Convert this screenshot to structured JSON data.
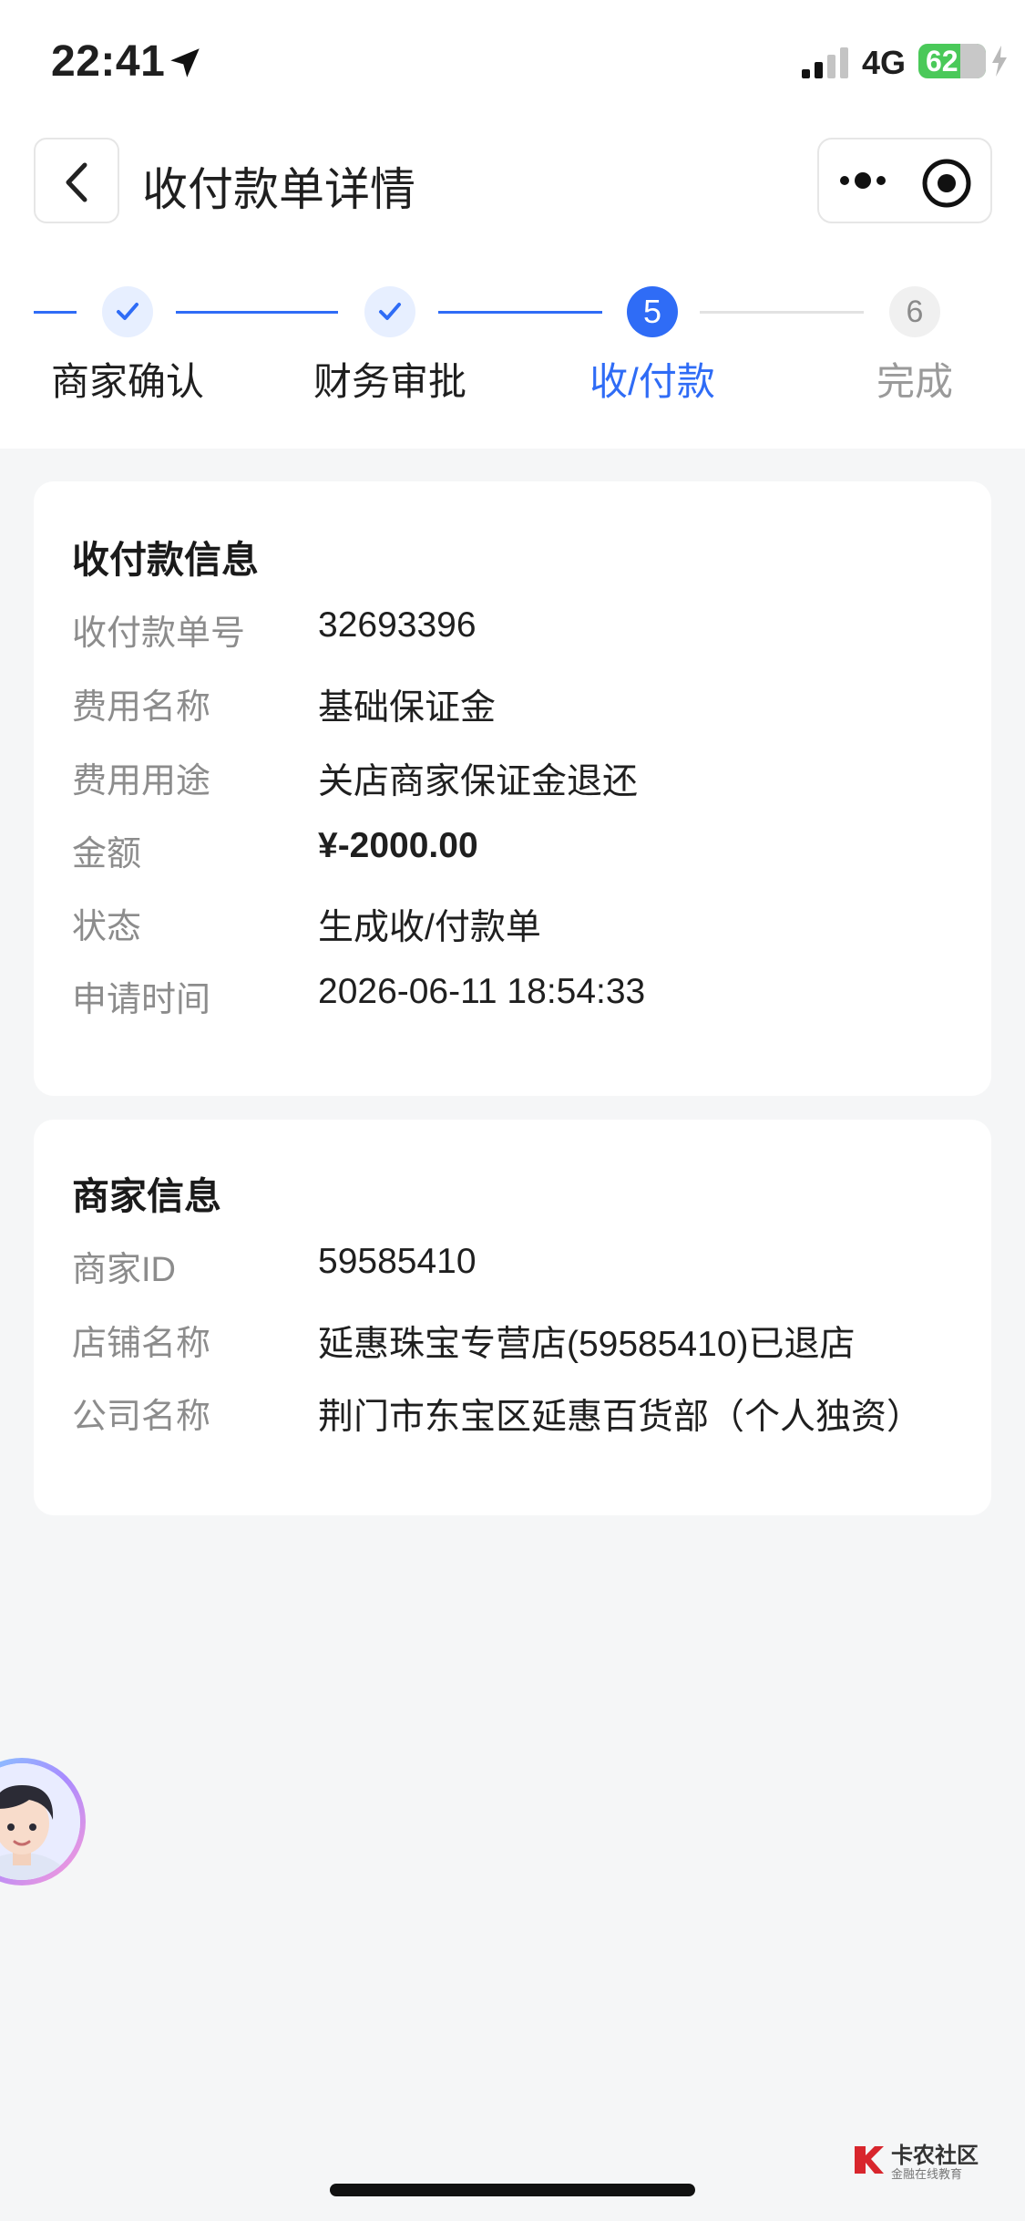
{
  "status_bar": {
    "time": "22:41",
    "network": "4G",
    "battery_level": "62"
  },
  "nav": {
    "title": "收付款单详情",
    "back_icon": "chevron-left-icon",
    "more_icon": "more-dots-icon",
    "close_icon": "target-circle-icon"
  },
  "steps": [
    {
      "label": "商家确认",
      "state": "done"
    },
    {
      "label": "财务审批",
      "state": "done"
    },
    {
      "number": "5",
      "label": "收/付款",
      "state": "active"
    },
    {
      "number": "6",
      "label": "完成",
      "state": "pending"
    }
  ],
  "payment_card": {
    "title": "收付款信息",
    "rows": [
      {
        "label": "收付款单号",
        "value": "32693396"
      },
      {
        "label": "费用名称",
        "value": "基础保证金"
      },
      {
        "label": "费用用途",
        "value": "关店商家保证金退还"
      },
      {
        "label": "金额",
        "value": "¥-2000.00"
      },
      {
        "label": "状态",
        "value": "生成收/付款单"
      },
      {
        "label": "申请时间",
        "value": "2026-06-11 18:54:33"
      }
    ]
  },
  "merchant_card": {
    "title": "商家信息",
    "rows": [
      {
        "label": "商家ID",
        "value": "59585410"
      },
      {
        "label": "店铺名称",
        "value": "延惠珠宝专营店(59585410)已退店"
      },
      {
        "label": "公司名称",
        "value": "荆门市东宝区延惠百货部（个人独资）"
      }
    ]
  },
  "watermark": {
    "name": "卡农社区",
    "tagline": "金融在线教育"
  },
  "colors": {
    "accent": "#2f6cf6",
    "background": "#f5f6f7",
    "label_gray": "#8c8c8c",
    "battery_green": "#4ac959"
  }
}
